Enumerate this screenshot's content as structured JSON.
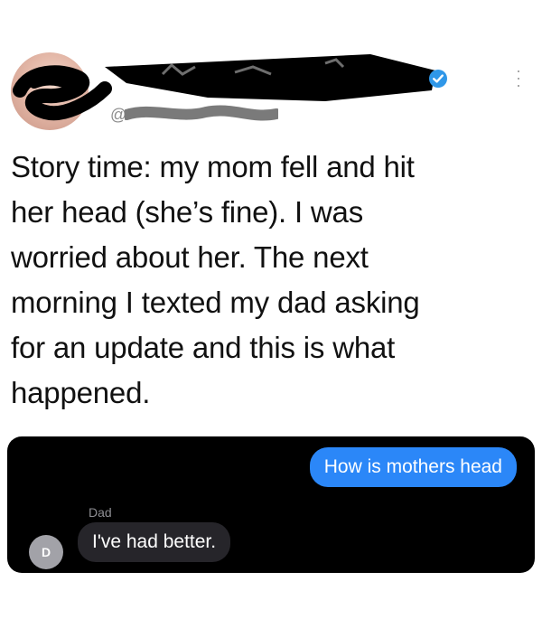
{
  "tweet": {
    "handle_prefix": "@",
    "text_lines": [
      "Story time: my mom fell and hit",
      "her head (she’s fine). I was",
      "worried about her. The next",
      "morning I texted my dad asking",
      "for an update and this is what",
      "happened."
    ]
  },
  "chat": {
    "sent_message": "How is mothers head",
    "sender_name": "Dad",
    "contact_initial": "D",
    "received_message": "I've had better."
  },
  "colors": {
    "sent_bubble": "#2b87f8",
    "received_bubble": "#26252a",
    "chat_background": "#000000",
    "verified_badge": "#2f97e8"
  },
  "icons": {
    "verified": "verified-badge-icon",
    "more": "more-vertical-icon"
  }
}
